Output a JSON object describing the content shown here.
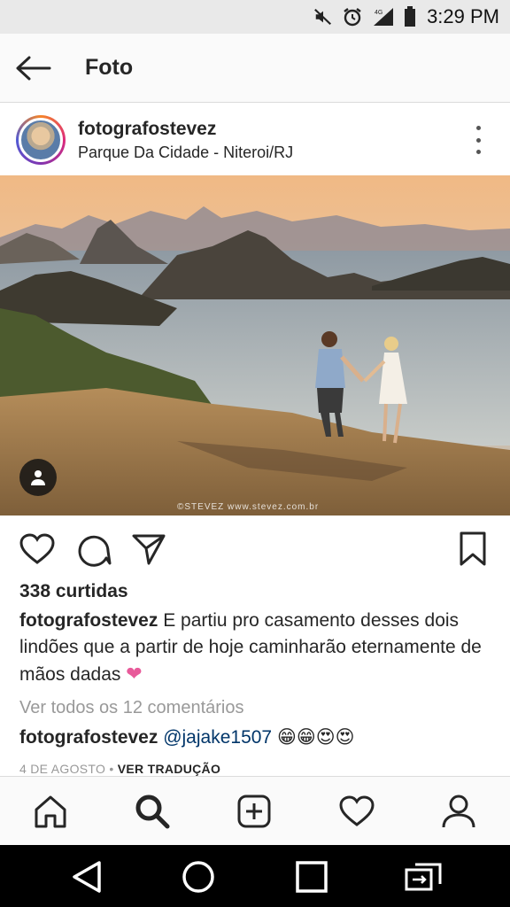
{
  "status_bar": {
    "time": "3:29 PM",
    "network": "4G",
    "icons": [
      "mute-icon",
      "alarm-icon",
      "signal-icon",
      "battery-icon"
    ]
  },
  "app_bar": {
    "title": "Foto",
    "back_icon": "arrow-left-icon"
  },
  "post": {
    "username": "fotografostevez",
    "location": "Parque Da Cidade - Niteroi/RJ",
    "photo_watermark": "©STEVEZ  www.stevez.com.br",
    "likes": "338 curtidas",
    "caption_user": "fotografostevez",
    "caption_text": " E partiu pro casamento desses dois lindões que a partir de hoje caminharão eternamente de mãos dadas ",
    "caption_emoji": "❤",
    "view_comments": "Ver todos os 12 comentários",
    "comment": {
      "user": "fotografostevez",
      "mention": "@jajake1507",
      "emojis": "😁😁😍😍"
    },
    "date": "4 DE AGOSTO",
    "separator": " • ",
    "translate": "VER TRADUÇÃO"
  },
  "actions": [
    "heart-icon",
    "comment-icon",
    "share-icon",
    "bookmark-icon"
  ],
  "bottom_nav": [
    "home-icon",
    "search-icon",
    "add-icon",
    "activity-icon",
    "profile-icon"
  ],
  "system_nav": [
    "back-icon",
    "home-circle-icon",
    "recents-icon",
    "screen-cast-icon"
  ],
  "colors": {
    "mention": "#003569",
    "muted_text": "#999999",
    "caption_heart": "#e85a9a"
  }
}
